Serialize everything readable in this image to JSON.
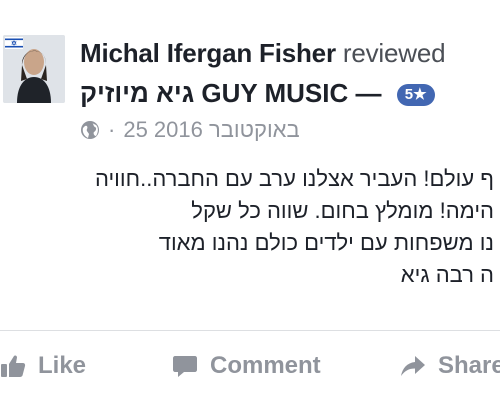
{
  "post": {
    "author_name": "Michal Ifergan Fisher",
    "verb": "reviewed",
    "page_name": "גיא מיוזיק GUY MUSIC",
    "separator": "—",
    "rating_label": "5★",
    "date": "25 באוקטובר 2016",
    "dot": "·",
    "review_lines": [
      "ף עולם! העביר אצלנו ערב עם החברה..חוויה",
      "הימה! מומלץ בחום. שווה כל שקל",
      "נו משפחות עם ילדים כולם נהנו מאוד",
      "ה רבה גיא"
    ]
  },
  "actions": {
    "like_label": "Like",
    "comment_label": "Comment",
    "share_label": "Share"
  },
  "icons": {
    "avatar": "profile-photo",
    "flag": "israel-flag-icon",
    "audience": "globe-icon",
    "like": "thumbs-up-icon",
    "comment": "speech-bubble-icon",
    "share": "share-arrow-icon"
  },
  "colors": {
    "brand": "#4267b2",
    "muted": "#90949c",
    "text": "#1d2129"
  }
}
